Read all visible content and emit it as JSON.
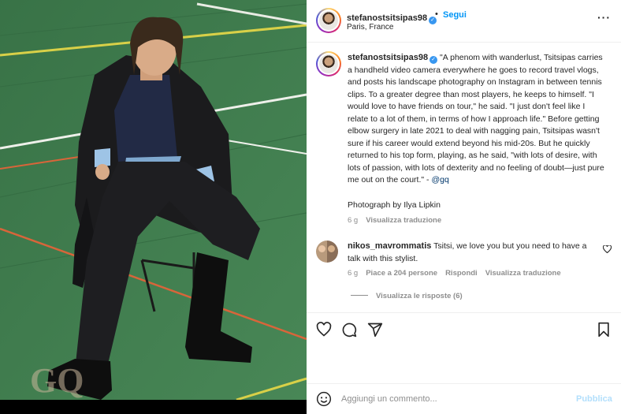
{
  "post": {
    "username": "stefanostsitsipas98",
    "follow_label": "Segui",
    "location": "Paris, France",
    "more_icon": "more-options-icon",
    "photo_watermark": "GQ"
  },
  "caption": {
    "username": "stefanostsitsipas98",
    "text": "\"A phenom with wanderlust, Tsitsipas carries a handheld video camera everywhere he goes to record travel vlogs, and posts his landscape photography on Instagram in between tennis clips. To a greater degree than most players, he keeps to himself. \"I would love to have friends on tour,\" he said. \"I just don't feel like I relate to a lot of them, in terms of how I approach life.\" Before getting elbow surgery in late 2021 to deal with nagging pain, Tsitsipas wasn't sure if his career would extend beyond his mid-20s. But he quickly returned to his top form, playing, as he said, \"with lots of desire, with lots of passion, with lots of dexterity and no feeling of doubt—just pure me out on the court.\" - ",
    "mention": "@gq",
    "credit": "Photograph by Ilya Lipkin",
    "age": "6 g",
    "translate_label": "Visualizza traduzione"
  },
  "comment": {
    "username": "nikos_mavrommatis",
    "text": "Tsitsi, we love you but you need to have a talk with this stylist.",
    "age": "6 g",
    "likes": "Piace a 204 persone",
    "reply_label": "Rispondi",
    "translate_label": "Visualizza traduzione",
    "view_replies": "Visualizza le risposte (6)"
  },
  "actions": {
    "icons": [
      "heart-icon",
      "comment-icon",
      "share-icon",
      "bookmark-icon"
    ]
  },
  "add_comment": {
    "placeholder": "Aggiungi un commento...",
    "publish_label": "Pubblica"
  },
  "colors": {
    "accent": "#0095f6",
    "court_green": "#3f7d4e",
    "muted_text": "#8e8e8e",
    "publish_disabled": "#b2dffc"
  }
}
